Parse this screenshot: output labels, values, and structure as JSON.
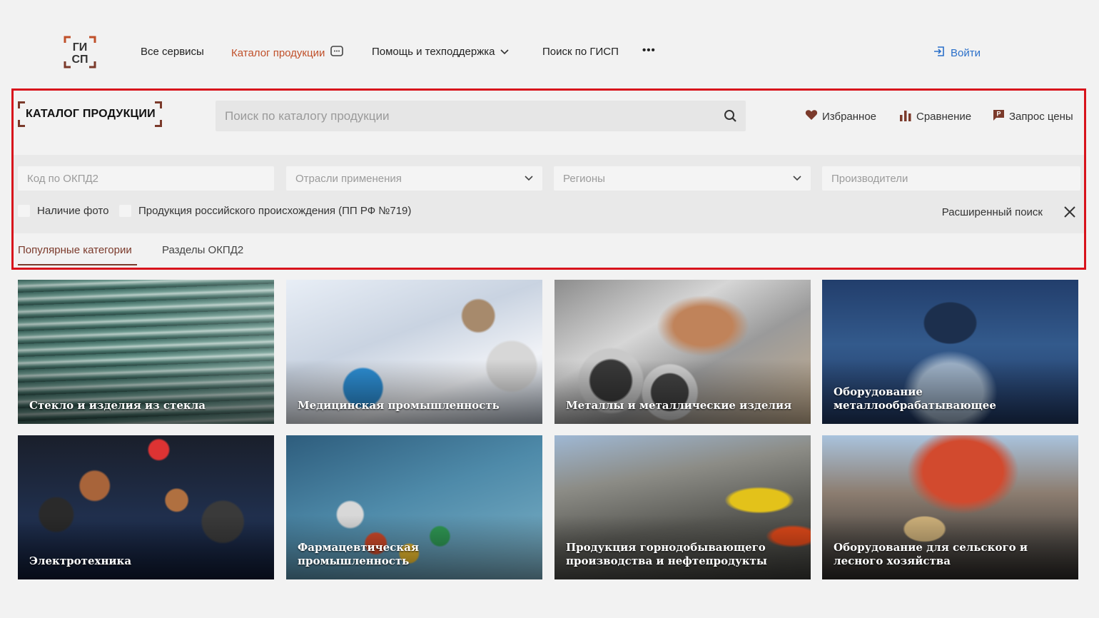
{
  "nav": {
    "items": [
      {
        "label": "Все сервисы"
      },
      {
        "label": "Каталог продукции"
      },
      {
        "label": "Помощь и техподдержка"
      },
      {
        "label": "Поиск по ГИСП"
      }
    ],
    "more": "•••",
    "login": "Войти",
    "logo_text": [
      "ГИ",
      "СП"
    ]
  },
  "catalog": {
    "title": "КАТАЛОГ ПРОДУКЦИИ",
    "search_placeholder": "Поиск по каталогу продукции",
    "actions": {
      "favorites": "Избранное",
      "compare": "Сравнение",
      "price_request": "Запрос цены"
    }
  },
  "filters": {
    "okpd_placeholder": "Код по ОКПД2",
    "industries_placeholder": "Отрасли применения",
    "regions_placeholder": "Регионы",
    "manufacturers_placeholder": "Производители",
    "photo_checkbox": "Наличие фото",
    "russian_checkbox": "Продукция российского происхождения (ПП РФ №719)",
    "advanced_search": "Расширенный поиск"
  },
  "tabs": [
    {
      "label": "Популярные категории",
      "active": true
    },
    {
      "label": "Разделы ОКПД2",
      "active": false
    }
  ],
  "categories": [
    {
      "label": "Стекло и изделия из стекла",
      "icon": "glass-image"
    },
    {
      "label": "Медицинская промышленность",
      "icon": "medical-image"
    },
    {
      "label": "Металлы и металлические изделия",
      "icon": "metal-image"
    },
    {
      "label": "Оборудование металлообрабатывающее",
      "icon": "machining-image"
    },
    {
      "label": "Электротехника",
      "icon": "electronics-image"
    },
    {
      "label": "Фармацевтическая промышленность",
      "icon": "pharma-image"
    },
    {
      "label": "Продукция горнодобывающего производства и нефтепродукты",
      "icon": "mining-image"
    },
    {
      "label": "Оборудование для сельского и лесного хозяйства",
      "icon": "agri-forest-image"
    }
  ],
  "colors": {
    "accent": "#c0502a",
    "brand": "#7b3a2b",
    "link": "#2a6fc9",
    "highlight": "#d8131c"
  }
}
